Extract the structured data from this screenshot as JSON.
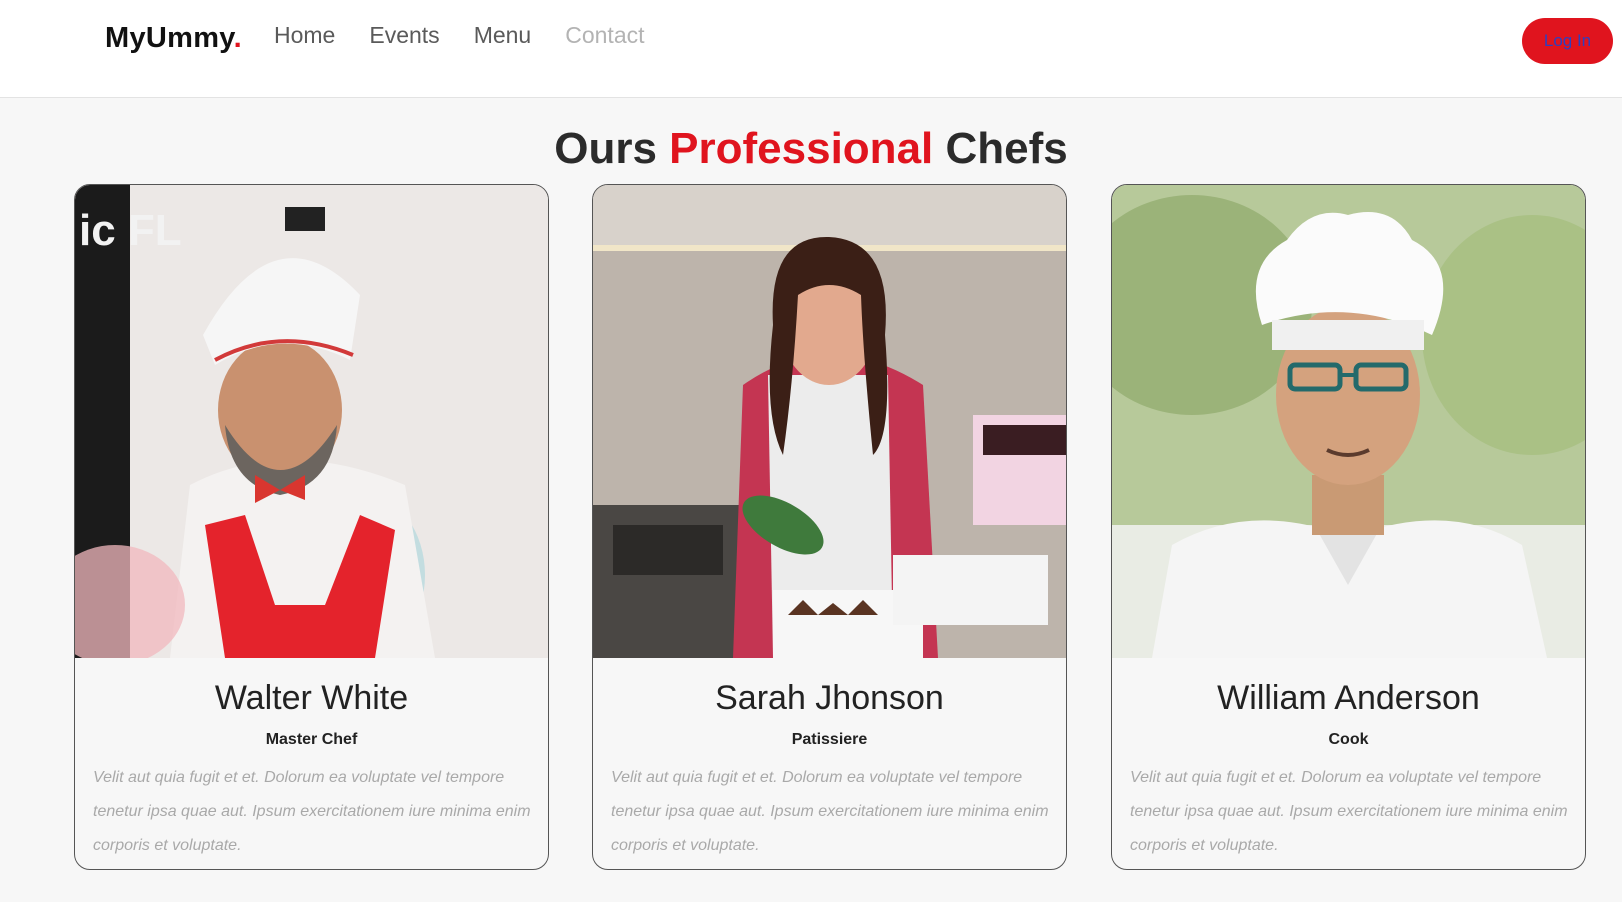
{
  "header": {
    "logo_text": "MyUmmy",
    "logo_dot": ".",
    "nav": [
      "Home",
      "Events",
      "Menu",
      "Contact"
    ],
    "login_label": "Log In"
  },
  "section": {
    "title_prefix": "Ours",
    "title_accent": "Professional",
    "title_suffix": "Chefs"
  },
  "chefs": [
    {
      "name": "Walter White",
      "role": "Master Chef",
      "bio": "Velit aut quia fugit et et. Dolorum ea voluptate vel tempore tenetur ipsa quae aut. Ipsum exercitationem iure minima enim corporis et voluptate.",
      "photo_text": "ic FL"
    },
    {
      "name": "Sarah Jhonson",
      "role": "Patissiere",
      "bio": "Velit aut quia fugit et et. Dolorum ea voluptate vel tempore tenetur ipsa quae aut. Ipsum exercitationem iure minima enim corporis et voluptate."
    },
    {
      "name": "William Anderson",
      "role": "Cook",
      "bio": "Velit aut quia fugit et et. Dolorum ea voluptate vel tempore tenetur ipsa quae aut. Ipsum exercitationem iure minima enim corporis et voluptate."
    }
  ],
  "colors": {
    "accent": "#e0141e",
    "background": "#f7f7f7",
    "muted_text": "#a9a9a9"
  }
}
